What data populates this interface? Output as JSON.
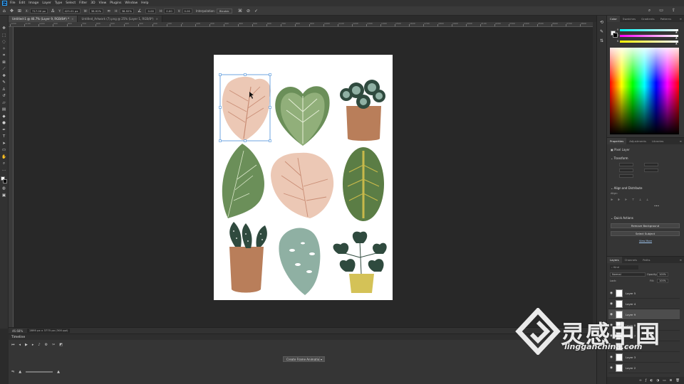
{
  "menubar": {
    "app_icon": "Ps",
    "items": [
      "File",
      "Edit",
      "Image",
      "Layer",
      "Type",
      "Select",
      "Filter",
      "3D",
      "View",
      "Plugins",
      "Window",
      "Help"
    ]
  },
  "options": {
    "x_label": "X:",
    "x_value": "717.00 px",
    "y_label": "Y:",
    "y_value": "425.01 px",
    "w_label": "W:",
    "w_value": "38.92%",
    "h_label": "H:",
    "h_value": "38.92%",
    "angle_value": "0.00",
    "hskew_label": "H:",
    "hskew_value": "0.00",
    "vskew_label": "V:",
    "vskew_value": "0.00",
    "interpolation_label": "Interpolation:",
    "interpolation_value": "Bicubic"
  },
  "tabs": [
    {
      "label": "Untitled-1 @ 46.7% (Layer 9, RGB/8#) *",
      "active": true
    },
    {
      "label": "Untitled_Artwork (7).png @ 25% (Layer 1, RGB/8*)",
      "active": false
    }
  ],
  "ruler_labels": [
    "1200",
    "1100",
    "1000",
    "900",
    "800",
    "700",
    "600",
    "500",
    "400",
    "300",
    "200",
    "100",
    "0",
    "100",
    "200",
    "300",
    "400",
    "500",
    "600",
    "700",
    "800",
    "900",
    "1000",
    "1100",
    "1200",
    "1300",
    "1400",
    "1500",
    "1600",
    "1700",
    "1800",
    "1900",
    "2000",
    "2100",
    "2200",
    "2300",
    "2400",
    "2500",
    "2600",
    "2700",
    "2800"
  ],
  "status": {
    "zoom": "46.68%",
    "doc_info": "2895 px x 3775 px (300 ppi)"
  },
  "timeline": {
    "title": "Timeline",
    "create_button": "Create Frame Animation"
  },
  "color_panel": {
    "tabs": [
      "Color",
      "Swatches",
      "Gradients",
      "Patterns"
    ],
    "channels": [
      "R",
      "G",
      "B"
    ],
    "accent": "#ffffff"
  },
  "properties": {
    "tabs": [
      "Properties",
      "Adjustments",
      "Libraries"
    ],
    "layer_kind": "Pixel Layer",
    "transform_title": "Transform",
    "align_title": "Align and Distribute",
    "align_label": "Align:",
    "quick_actions_title": "Quick Actions",
    "remove_bg": "Remove Background",
    "select_subject": "Select Subject",
    "view_more": "View More"
  },
  "layers": {
    "tabs": [
      "Layers",
      "Channels",
      "Paths"
    ],
    "search": "Kind",
    "blend_mode": "Normal",
    "opacity_label": "Opacity:",
    "opacity_value": "100%",
    "lock_label": "Lock:",
    "fill_label": "Fill:",
    "fill_value": "100%",
    "items": [
      {
        "name": "Layer 5",
        "selected": false
      },
      {
        "name": "Layer 4",
        "selected": false
      },
      {
        "name": "Layer 9",
        "selected": true
      },
      {
        "name": "Layer 8",
        "selected": false
      },
      {
        "name": "Layer 7",
        "selected": false
      },
      {
        "name": "Layer 6",
        "selected": false
      },
      {
        "name": "Layer 3",
        "selected": false
      },
      {
        "name": "Layer 2",
        "selected": false
      }
    ]
  },
  "watermark": {
    "cn": "灵感中国",
    "en": "lingganchina.com"
  },
  "colors": {
    "leaf_pink": "#ecc8b5",
    "leaf_green": "#6b8f59",
    "leaf_dark": "#2f4a3e",
    "pot_brown": "#b97e5a",
    "pot_yellow": "#d4c257",
    "leaf_teal": "#8fb0a3",
    "selection": "#4a90d9"
  }
}
